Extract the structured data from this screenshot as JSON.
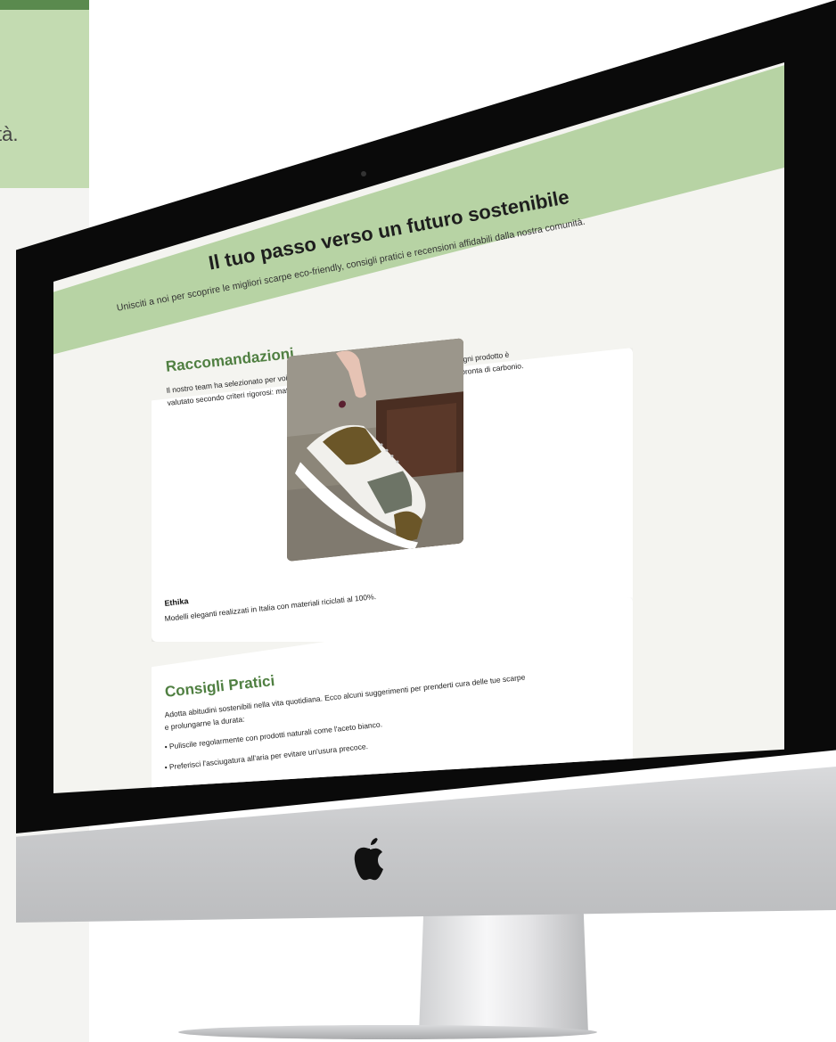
{
  "background_page": {
    "visible_fragment": "tà."
  },
  "site": {
    "title": "Il tuo passo verso un futuro sostenibile",
    "subtitle": "Unisciti a noi per scoprire le migliori scarpe eco-friendly, consigli pratici e recensioni affidabili dalla nostra comunità.",
    "colors": {
      "header_bg": "#b7d3a4",
      "accent": "#4f7f41",
      "page_bg": "#f4f4f0"
    }
  },
  "recommendations": {
    "title": "Raccomandazioni",
    "intro_line1": "Il nostro team ha selezionato per voi i migliori marchi di scarpe rispettosi dell'ambiente. Ogni prodotto è",
    "intro_line2": "valutato secondo criteri rigorosi: materiali sostenibili, produzione etica e riduzione dell'impronta di carbonio.",
    "product": {
      "image_subject": "sneaker-photo",
      "name": "Ethika",
      "description": "Modelli eleganti realizzati in Italia con materiali riciclati al 100%."
    }
  },
  "tips": {
    "title": "Consigli Pratici",
    "intro_line1": "Adotta abitudini sostenibili nella vita quotidiana. Ecco alcuni suggerimenti per prenderti cura delle tue scarpe",
    "intro_line2": "e prolungarne la durata:",
    "items": [
      "Puliscile regolarmente con prodotti naturali come l'aceto bianco.",
      "Preferisci l'asciugatura all'aria per evitare un'usura precoce."
    ]
  },
  "device": {
    "logo_icon": "apple-logo-icon"
  }
}
